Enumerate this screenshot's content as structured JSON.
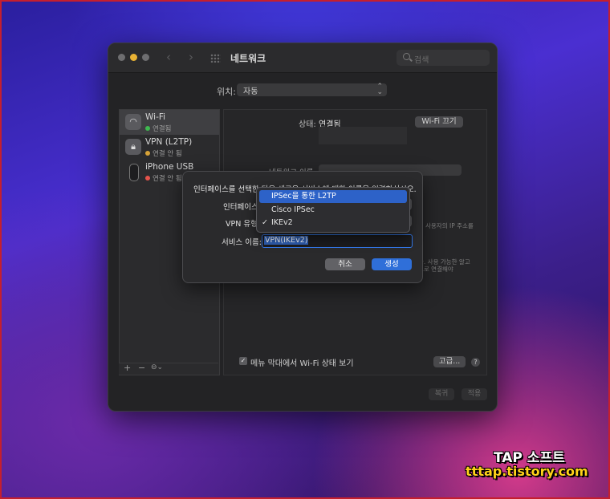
{
  "window": {
    "title": "네트워크",
    "search_placeholder": "검색",
    "location_label": "위치:",
    "location_value": "자동"
  },
  "sidebar": {
    "items": [
      {
        "name": "Wi-Fi",
        "status": "연결됨",
        "status_color": "#3fb950"
      },
      {
        "name": "VPN (L2TP)",
        "status": "연결 안 됨",
        "status_color": "#d6a238"
      },
      {
        "name": "iPhone USB",
        "status": "연결 안 됨",
        "status_color": "#e5534b"
      }
    ],
    "tools": {
      "add": "+",
      "remove": "−",
      "action": "⊖⌄"
    }
  },
  "panel": {
    "status_label": "상태:",
    "status_value": "연결됨",
    "wifi_off_button": "Wi-Fi 끄기",
    "network_name_label": "네트워크 이름:",
    "ip_note": "사용자의 IP 주소를",
    "note_line1": "다. 사용 가능한 알고",
    "note_line2": "으로 연결해야",
    "menubar_checkbox_label": "메뉴 막대에서 Wi-Fi 상태 보기",
    "advanced_button": "고급...",
    "help_button": "?",
    "revert_button": "복귀",
    "apply_button": "적용"
  },
  "sheet": {
    "message": "인터페이스를 선택한 다음 새로운 서비스에 대한 이름을 입력하십시오.",
    "interface_label": "인터페이스",
    "vpn_type_label": "VPN 유형",
    "service_name_label": "서비스 이름:",
    "service_name_value": "VPN(IKEv2)",
    "cancel_button": "취소",
    "create_button": "생성"
  },
  "vpn_type_menu": {
    "options": [
      "IPSec을 통한 L2TP",
      "Cisco IPSec",
      "IKEv2"
    ],
    "highlighted_index": 0,
    "selected_value": "IKEv2",
    "check_mark": "✓"
  },
  "watermark": {
    "line1": "TAP 소프트",
    "line2": "tttap.tistory.com"
  }
}
